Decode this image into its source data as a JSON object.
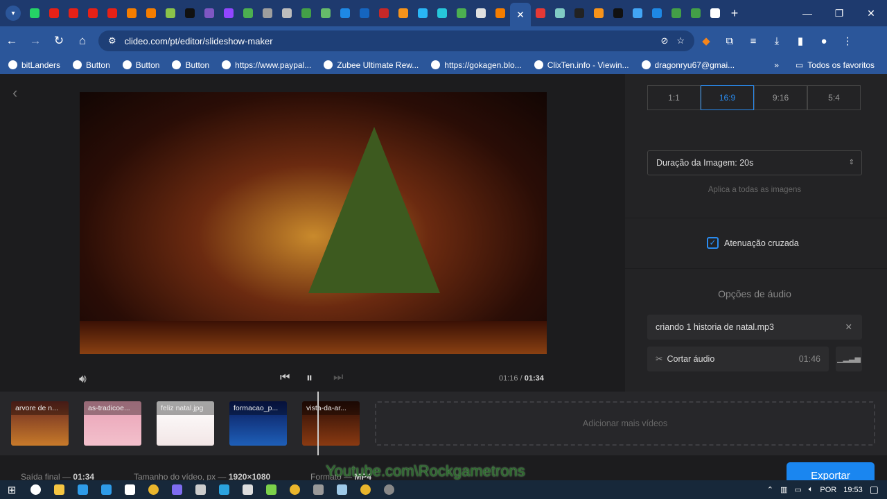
{
  "browser": {
    "tabs": [
      {
        "icon": "whatsapp-icon",
        "color": "#25d366"
      },
      {
        "icon": "youtube-icon",
        "color": "#e62117"
      },
      {
        "icon": "youtube-icon",
        "color": "#e62117"
      },
      {
        "icon": "youtube-icon",
        "color": "#e62117"
      },
      {
        "icon": "youtube-icon",
        "color": "#e62117"
      },
      {
        "icon": "blogger-icon",
        "color": "#f57d00"
      },
      {
        "icon": "blogger-icon",
        "color": "#f57d00"
      },
      {
        "icon": "tab-icon",
        "color": "#8bc34a"
      },
      {
        "icon": "tiktok-icon",
        "color": "#111111"
      },
      {
        "icon": "tab-icon",
        "color": "#7e57c2"
      },
      {
        "icon": "twitch-icon",
        "color": "#9146ff"
      },
      {
        "icon": "play-icon",
        "color": "#4caf50"
      },
      {
        "icon": "tab-icon",
        "color": "#9e9e9e"
      },
      {
        "icon": "tab-icon",
        "color": "#bdbdbd"
      },
      {
        "icon": "tab-icon",
        "color": "#43a047"
      },
      {
        "icon": "tab-icon",
        "color": "#66bb6a"
      },
      {
        "icon": "tab-icon",
        "color": "#1e88e5"
      },
      {
        "icon": "tab-icon",
        "color": "#1565c0"
      },
      {
        "icon": "tab-icon",
        "color": "#c62828"
      },
      {
        "icon": "bitcoin-icon",
        "color": "#f7931a"
      },
      {
        "icon": "tab-icon",
        "color": "#29b6f6"
      },
      {
        "icon": "tab-icon",
        "color": "#26c6da"
      },
      {
        "icon": "tab-icon",
        "color": "#4caf50"
      },
      {
        "icon": "tab-icon",
        "color": "#e0e0e0"
      },
      {
        "icon": "blogger-icon",
        "color": "#f57d00"
      }
    ],
    "active_tab_close": "✕",
    "tabs_after": [
      {
        "icon": "tab-icon",
        "color": "#e53935"
      },
      {
        "icon": "tab-icon",
        "color": "#80cbc4"
      },
      {
        "icon": "tab-icon",
        "color": "#222222"
      },
      {
        "icon": "bitcoin-icon",
        "color": "#f7931a"
      },
      {
        "icon": "tab-icon",
        "color": "#111111"
      },
      {
        "icon": "tab-icon",
        "color": "#42a5f5"
      },
      {
        "icon": "tab-icon",
        "color": "#1e88e5"
      },
      {
        "icon": "tab-icon",
        "color": "#43a047"
      },
      {
        "icon": "tab-icon",
        "color": "#43a047"
      },
      {
        "icon": "google-icon",
        "color": "#ffffff"
      }
    ],
    "new_tab": "+",
    "url": "clideo.com/pt/editor/slideshow-maker",
    "bookmarks": [
      "bitLanders",
      "Button",
      "Button",
      "Button",
      "https://www.paypal...",
      "Zubee Ultimate Rew...",
      "https://gokagen.blo...",
      "ClixTen.info - Viewin...",
      "dragonryu67@gmai..."
    ],
    "bookmarks_more": "»",
    "all_bookmarks": "Todos os favoritos"
  },
  "editor": {
    "back": "‹",
    "time_current": "01:16",
    "time_sep": "/",
    "time_total": "01:34",
    "ratios": [
      "1:1",
      "16:9",
      "9:16",
      "5:4"
    ],
    "selected_ratio": "16:9",
    "duration_label": "Duração da Imagem: 20s",
    "duration_hint": "Aplica a todas as imagens",
    "crossfade_label": "Atenuação cruzada",
    "crossfade_checked": true,
    "audio_heading": "Opções de áudio",
    "audio_file": "criando 1 historia de natal.mp3",
    "cut_audio": "Cortar áudio",
    "audio_duration": "01:46",
    "clips": [
      {
        "name": "arvore de n...",
        "bg": "linear-gradient(#6b2a22,#c77a2a)"
      },
      {
        "name": "as-tradicoe...",
        "bg": "linear-gradient(#e9a2b6,#f3c0cc)"
      },
      {
        "name": "feliz natal.jpg",
        "bg": "linear-gradient(#ffffff,#f2e6e6)"
      },
      {
        "name": "formacao_p...",
        "bg": "linear-gradient(#0a1a5a,#1e5fb8)"
      },
      {
        "name": "vista-da-ar...",
        "bg": "linear-gradient(#2a0d06,#8a3a12)"
      }
    ],
    "add_more": "Adicionar mais vídeos",
    "footer": {
      "output_label": "Saída final —",
      "output_value": "01:34",
      "size_label": "Tamanho do vídeo, px —",
      "size_value": "1920×1080",
      "format_label": "Formato —",
      "format_value": "MP4"
    },
    "export": "Exportar",
    "watermark": "Youtube.com\\Rockgametrons"
  },
  "taskbar": {
    "apps": [
      {
        "icon": "search-icon",
        "color": "#ffffff"
      },
      {
        "icon": "file-explorer-icon",
        "color": "#f4c542"
      },
      {
        "icon": "edge-icon",
        "color": "#2e9be8"
      },
      {
        "icon": "mail-icon",
        "color": "#2e9be8"
      },
      {
        "icon": "store-icon",
        "color": "#ffffff"
      },
      {
        "icon": "chrome-icon",
        "color": "#e9b52c"
      },
      {
        "icon": "app-icon",
        "color": "#7e6cf0"
      },
      {
        "icon": "app-icon",
        "color": "#cccccc"
      },
      {
        "icon": "telegram-icon",
        "color": "#2aa3e0"
      },
      {
        "icon": "app-icon",
        "color": "#dddddd"
      },
      {
        "icon": "app-icon",
        "color": "#7bd14a"
      },
      {
        "icon": "chrome-icon",
        "color": "#e9b52c"
      },
      {
        "icon": "calculator-icon",
        "color": "#999999"
      },
      {
        "icon": "notepad-icon",
        "color": "#9ec9e8"
      },
      {
        "icon": "chrome-icon",
        "color": "#e9b52c"
      },
      {
        "icon": "obs-icon",
        "color": "#888888"
      }
    ],
    "lang": "POR",
    "time": "19:53"
  }
}
